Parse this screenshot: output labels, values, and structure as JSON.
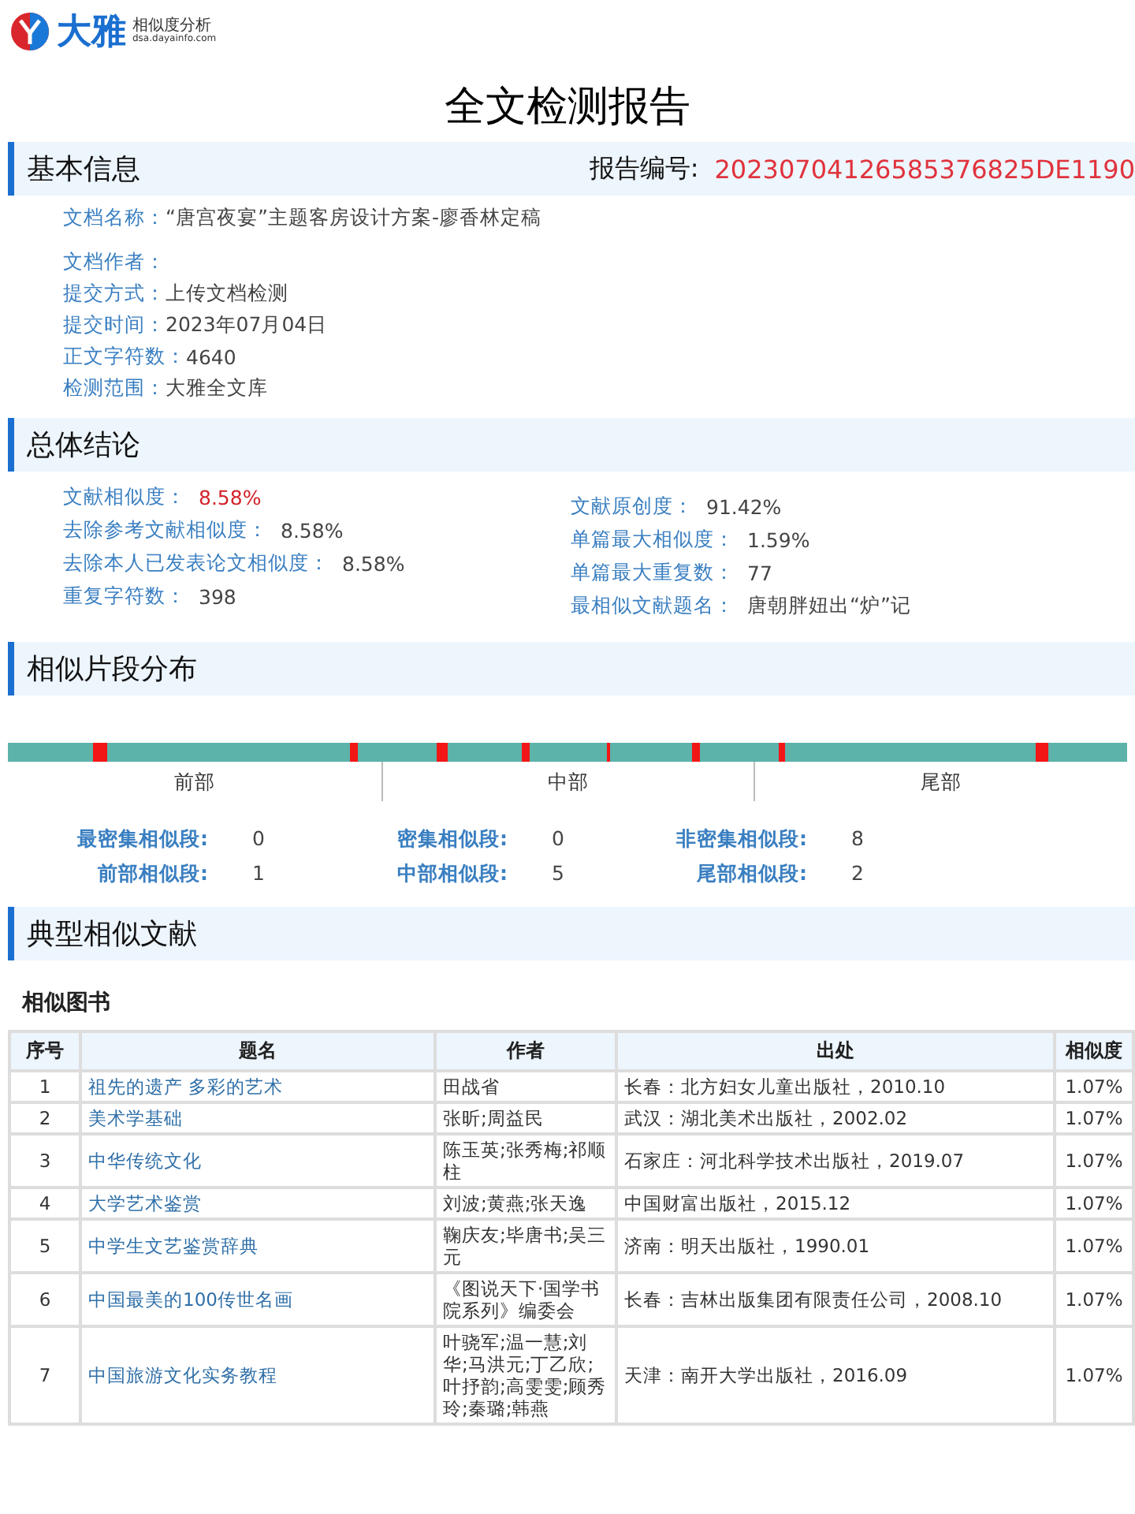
{
  "brand": {
    "name": "大雅",
    "tagline": "相似度分析",
    "url": "dsa.dayainfo.com"
  },
  "title": "全文检测报告",
  "basic_info": {
    "heading": "基本信息",
    "report_no_label": "报告编号:",
    "report_no": "20230704126585376825DE1190",
    "fields": [
      {
        "label": "文档名称：",
        "value": "“唐宫夜宴”主题客房设计方案-廖香林定稿"
      },
      {
        "label": "文档作者："
      },
      {
        "label": "提交方式：",
        "value": "上传文档检测"
      },
      {
        "label": "提交时间：",
        "value": "2023年07月04日"
      },
      {
        "label": "正文字符数：",
        "value": "4640"
      },
      {
        "label": "检测范围：",
        "value": "大雅全文库"
      }
    ]
  },
  "conclusion": {
    "heading": "总体结论",
    "left": [
      {
        "label": "文献相似度：",
        "value": "8.58%",
        "highlight": true
      },
      {
        "label": "去除参考文献相似度：",
        "value": "8.58%",
        "highlight": false
      },
      {
        "label": "去除本人已发表论文相似度：",
        "value": "8.58%",
        "highlight": false
      },
      {
        "label": "重复字符数：",
        "value": "398",
        "highlight": false
      }
    ],
    "right": [
      {
        "label": "文献原创度：",
        "value": "91.42%",
        "highlight": false
      },
      {
        "label": "单篇最大相似度：",
        "value": "1.59%",
        "highlight": false
      },
      {
        "label": "单篇最大重复数：",
        "value": "77",
        "highlight": false
      },
      {
        "label": "最相似文献题名：",
        "value": "唐朝胖妞出“炉”记",
        "highlight": false
      }
    ]
  },
  "distribution": {
    "heading": "相似片段分布",
    "parts": [
      "前部",
      "中部",
      "尾部"
    ],
    "stats": [
      {
        "label": "最密集相似段:",
        "value": "0"
      },
      {
        "label": "密集相似段:",
        "value": "0"
      },
      {
        "label": "非密集相似段:",
        "value": "8"
      },
      {
        "label": "前部相似段:",
        "value": "1"
      },
      {
        "label": "中部相似段:",
        "value": "5"
      },
      {
        "label": "尾部相似段:",
        "value": "2"
      }
    ]
  },
  "typical": {
    "heading": "典型相似文献",
    "subheading": "相似图书",
    "table": {
      "columns": [
        "序号",
        "题名",
        "作者",
        "出处",
        "相似度"
      ],
      "rows": [
        [
          "1",
          "祖先的遗产 多彩的艺术",
          "田战省",
          "长春：北方妇女儿童出版社，2010.10",
          "1.07%"
        ],
        [
          "2",
          "美术学基础",
          "张昕;周益民",
          "武汉：湖北美术出版社，2002.02",
          "1.07%"
        ],
        [
          "3",
          "中华传统文化",
          "陈玉英;张秀梅;祁顺柱",
          "石家庄：河北科学技术出版社，2019.07",
          "1.07%"
        ],
        [
          "4",
          "大学艺术鉴赏",
          "刘波;黄燕;张天逸",
          "中国财富出版社，2015.12",
          "1.07%"
        ],
        [
          "5",
          "中学生文艺鉴赏辞典",
          "鞠庆友;毕唐书;吴三元",
          "济南：明天出版社，1990.01",
          "1.07%"
        ],
        [
          "6",
          "中国最美的100传世名画",
          "《图说天下·国学书院系列》编委会",
          "长春：吉林出版集团有限责任公司，2008.10",
          "1.07%"
        ],
        [
          "7",
          "中国旅游文化实务教程",
          "叶骁军;温一慧;刘华;马洪元;丁乙欣;叶抒韵;高雯雯;顾秀玲;秦璐;韩燕",
          "天津：南开大学出版社，2016.09",
          "1.07%"
        ]
      ]
    }
  }
}
